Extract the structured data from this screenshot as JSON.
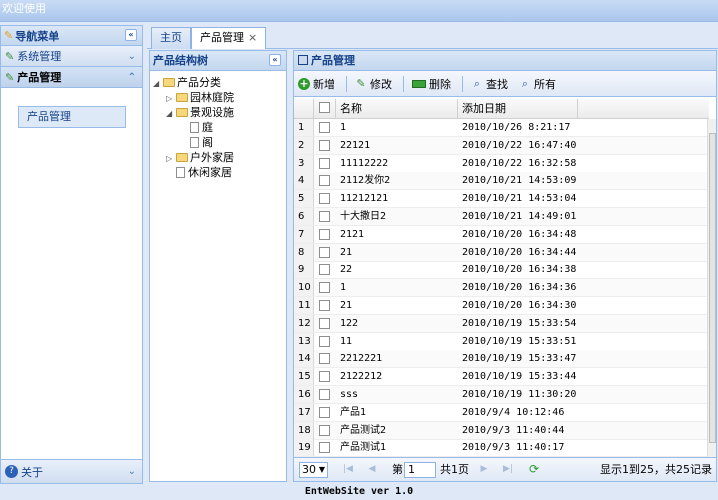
{
  "window": {
    "title": "欢迎使用"
  },
  "nav": {
    "title": "导航菜单",
    "sections": [
      {
        "label": "系统管理"
      },
      {
        "label": "产品管理"
      }
    ],
    "active_link": "产品管理",
    "bottom": "关于"
  },
  "tabs": [
    {
      "label": "主页"
    },
    {
      "label": "产品管理",
      "close": "×"
    }
  ],
  "tree": {
    "title": "产品结构树",
    "nodes": [
      {
        "label": "产品分类"
      },
      {
        "label": "园林庭院"
      },
      {
        "label": "景观设施"
      },
      {
        "label": "庭"
      },
      {
        "label": "阁"
      },
      {
        "label": "户外家居"
      },
      {
        "label": "休闲家居"
      }
    ]
  },
  "grid": {
    "title": "产品管理",
    "toolbar": {
      "add": "新增",
      "edit": "修改",
      "delete": "删除",
      "search": "查找",
      "all": "所有"
    },
    "columns": {
      "name": "名称",
      "date": "添加日期"
    },
    "rows": [
      {
        "n": "1",
        "name": "1",
        "date": "2010/10/26 8:21:17"
      },
      {
        "n": "2",
        "name": "22121",
        "date": "2010/10/22 16:47:40"
      },
      {
        "n": "3",
        "name": "11112222",
        "date": "2010/10/22 16:32:58"
      },
      {
        "n": "4",
        "name": "2112发你2",
        "date": "2010/10/21 14:53:09"
      },
      {
        "n": "5",
        "name": "11212121",
        "date": "2010/10/21 14:53:04"
      },
      {
        "n": "6",
        "name": "十大撒日2",
        "date": "2010/10/21 14:49:01"
      },
      {
        "n": "7",
        "name": "2121",
        "date": "2010/10/20 16:34:48"
      },
      {
        "n": "8",
        "name": "21",
        "date": "2010/10/20 16:34:44"
      },
      {
        "n": "9",
        "name": "22",
        "date": "2010/10/20 16:34:38"
      },
      {
        "n": "10",
        "name": "1",
        "date": "2010/10/20 16:34:36"
      },
      {
        "n": "11",
        "name": "21",
        "date": "2010/10/20 16:34:30"
      },
      {
        "n": "12",
        "name": "122",
        "date": "2010/10/19 15:33:54"
      },
      {
        "n": "13",
        "name": "11",
        "date": "2010/10/19 15:33:51"
      },
      {
        "n": "14",
        "name": "2212221",
        "date": "2010/10/19 15:33:47"
      },
      {
        "n": "15",
        "name": "2122212",
        "date": "2010/10/19 15:33:44"
      },
      {
        "n": "16",
        "name": "sss",
        "date": "2010/10/19 11:30:20"
      },
      {
        "n": "17",
        "name": "产品1",
        "date": "2010/9/4 10:12:46"
      },
      {
        "n": "18",
        "name": "产品测试2",
        "date": "2010/9/3 11:40:44"
      },
      {
        "n": "19",
        "name": "产品测试1",
        "date": "2010/9/3 11:40:17"
      }
    ],
    "pager": {
      "page_size": "30",
      "page_prefix": "第",
      "page_value": "1",
      "page_suffix": "共1页",
      "summary": "显示1到25，共25记录"
    }
  },
  "footer": {
    "text": "EntWebSite ver 1.0"
  }
}
